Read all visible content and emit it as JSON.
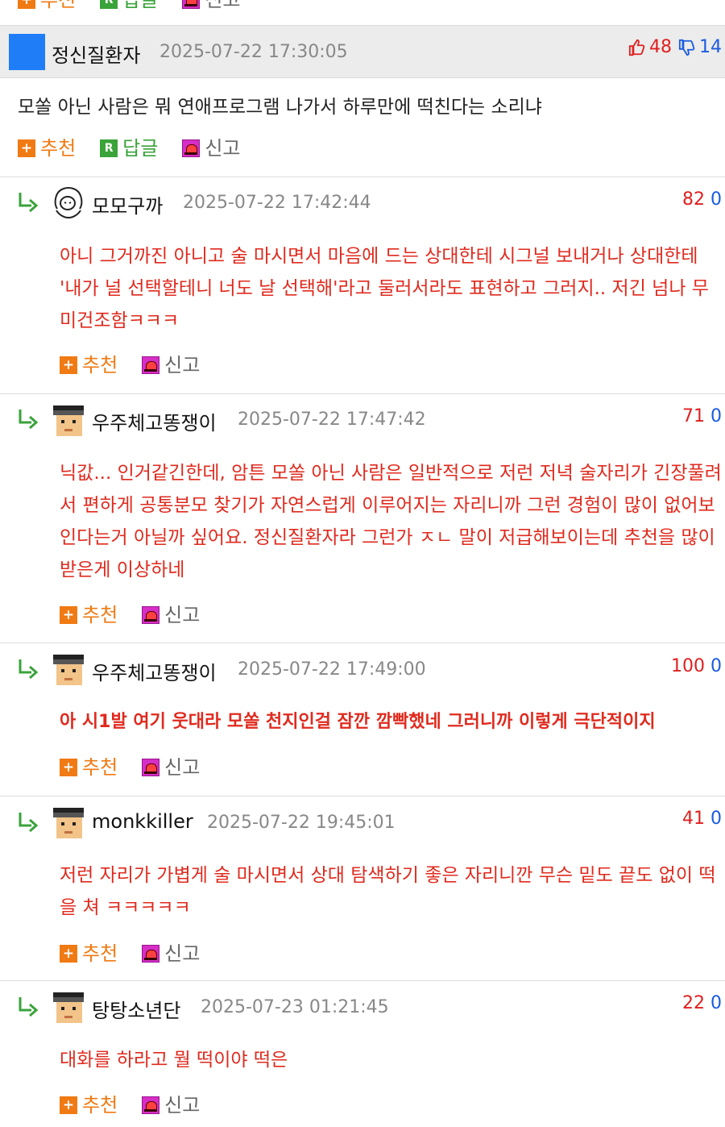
{
  "actions": {
    "recommend": "추천",
    "reply": "답글",
    "report": "신고"
  },
  "post": {
    "username": "정신질환자",
    "timestamp": "2025-07-22 17:30:05",
    "upvotes": "48",
    "downvotes": "14",
    "body": "모쏠 아닌 사람은 뭐 연애프로그램 나가서 하루만에 떡친다는 소리냐"
  },
  "comments": [
    {
      "username": "모모구까",
      "timestamp": "2025-07-22 17:42:44",
      "upvotes": "82",
      "downvotes": "0",
      "body": "아니 그거까진 아니고 술 마시면서 마음에 드는 상대한테 시그널 보내거나 상대한테 '내가 널 선택할테니 너도 날 선택해'라고 둘러서라도 표현하고 그러지.. 저긴 넘나 무미건조함ㅋㅋㅋ"
    },
    {
      "username": "우주체고똥쟁이",
      "timestamp": "2025-07-22 17:47:42",
      "upvotes": "71",
      "downvotes": "0",
      "body": "닉값... 인거같긴한데, 암튼 모쏠 아닌 사람은 일반적으로 저런 저녁 술자리가 긴장풀려서 편하게 공통분모 찾기가 자연스럽게 이루어지는 자리니까 그런 경험이 많이 없어보인다는거 아닐까 싶어요. 정신질환자라 그런가 ㅈㄴ 말이 저급해보이는데 추천을 많이받은게 이상하네"
    },
    {
      "username": "우주체고똥쟁이",
      "timestamp": "2025-07-22 17:49:00",
      "upvotes": "100",
      "downvotes": "0",
      "body": "아 시1발 여기 웃대라 모쏠 천지인걸 잠깐 깜빡했네 그러니까 이렇게 극단적이지"
    },
    {
      "username": "monkkiller",
      "timestamp": "2025-07-22 19:45:01",
      "upvotes": "41",
      "downvotes": "0",
      "body": "저런 자리가 가볍게 술 마시면서 상대 탐색하기 좋은 자리니깐 무슨 밑도 끝도 없이 떡을 쳐 ㅋㅋㅋㅋㅋ"
    },
    {
      "username": "탕탕소년단",
      "timestamp": "2025-07-23 01:21:45",
      "upvotes": "22",
      "downvotes": "0",
      "body": "대화를 하라고 뭘 떡이야 떡은"
    }
  ],
  "colors": {
    "accent_orange": "#f07a13",
    "reply_green": "#3aa33a",
    "comment_red": "#e02a1e",
    "down_blue": "#1a5be0",
    "avatar_blue": "#1f7ef7"
  }
}
